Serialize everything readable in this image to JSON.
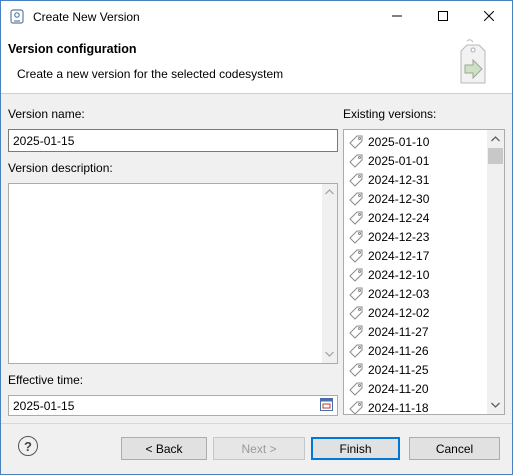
{
  "window": {
    "title": "Create New Version"
  },
  "header": {
    "title": "Version configuration",
    "subtitle": "Create a new version for the selected codesystem"
  },
  "form": {
    "version_name_label": "Version name:",
    "version_name_value": "2025-01-15",
    "version_description_label": "Version description:",
    "version_description_value": "",
    "effective_time_label": "Effective time:",
    "effective_time_value": "2025-01-15"
  },
  "existing": {
    "label": "Existing versions:",
    "items": [
      "2025-01-10",
      "2025-01-01",
      "2024-12-31",
      "2024-12-30",
      "2024-12-24",
      "2024-12-23",
      "2024-12-17",
      "2024-12-10",
      "2024-12-03",
      "2024-12-02",
      "2024-11-27",
      "2024-11-26",
      "2024-11-25",
      "2024-11-20",
      "2024-11-18"
    ]
  },
  "buttons": {
    "help": "?",
    "back": "< Back",
    "next": "Next >",
    "finish": "Finish",
    "cancel": "Cancel"
  },
  "icons": {
    "app": "version-app-icon",
    "minimize": "minimize-icon",
    "maximize": "maximize-icon",
    "close": "close-icon",
    "wizard": "version-wizard-icon",
    "tag": "tag-icon",
    "calendar": "calendar-icon",
    "help": "help-icon"
  }
}
